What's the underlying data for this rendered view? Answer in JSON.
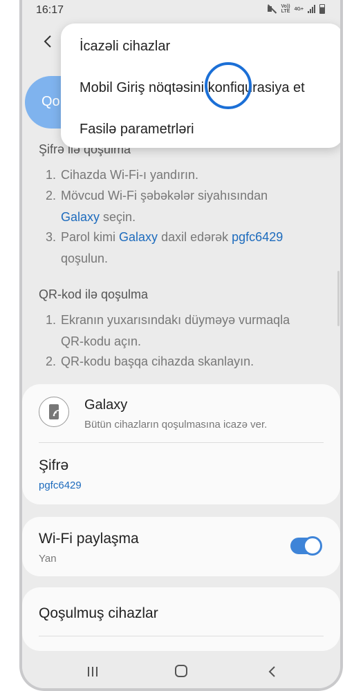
{
  "status_bar": {
    "time": "16:17",
    "volte_line1": "Vo))",
    "volte_line2": "LTE",
    "network": "4G+"
  },
  "header": {
    "pill_text": "Qo"
  },
  "menu": {
    "items": [
      {
        "label": "İcazəli cihazlar"
      },
      {
        "label": "Mobil Giriş nöqtəsini konfiqurasiya et"
      },
      {
        "label": "Fasilə parametrləri"
      }
    ]
  },
  "password_section": {
    "heading": "Şifrə ilə qoşulma",
    "step1": {
      "num": "1.",
      "text": "Cihazda Wi-Fi-ı yandırın."
    },
    "step2": {
      "num": "2.",
      "text_a": "Mövcud Wi-Fi şəbəkələr siyahısından",
      "link": "Galaxy",
      "text_b": "seçin."
    },
    "step3": {
      "num": "3.",
      "text_a": "Parol kimi",
      "link1": "Galaxy",
      "text_b": "daxil edərək",
      "link2": "pgfc6429",
      "text_c": "qoşulun."
    }
  },
  "qr_section": {
    "heading": "QR-kod ilə qoşulma",
    "step1": {
      "num": "1.",
      "text_a": "Ekranın yuxarısındakı düyməyə vurmaqla",
      "text_b": "QR-kodu açın."
    },
    "step2": {
      "num": "2.",
      "text": "QR-kodu başqa cihazda skanlayın."
    }
  },
  "network_card": {
    "name": "Galaxy",
    "subtitle": "Bütün cihazların qoşulmasına icazə ver.",
    "password_label": "Şifrə",
    "password_value": "pgfc6429"
  },
  "share_card": {
    "label": "Wi-Fi paylaşma",
    "state": "Yan",
    "toggle_on": true
  },
  "devices_card": {
    "label": "Qoşulmuş cihazlar"
  },
  "colors": {
    "accent": "#3e84d8",
    "link": "#1d6bbd",
    "touch_indicator": "#1b6fd6"
  }
}
